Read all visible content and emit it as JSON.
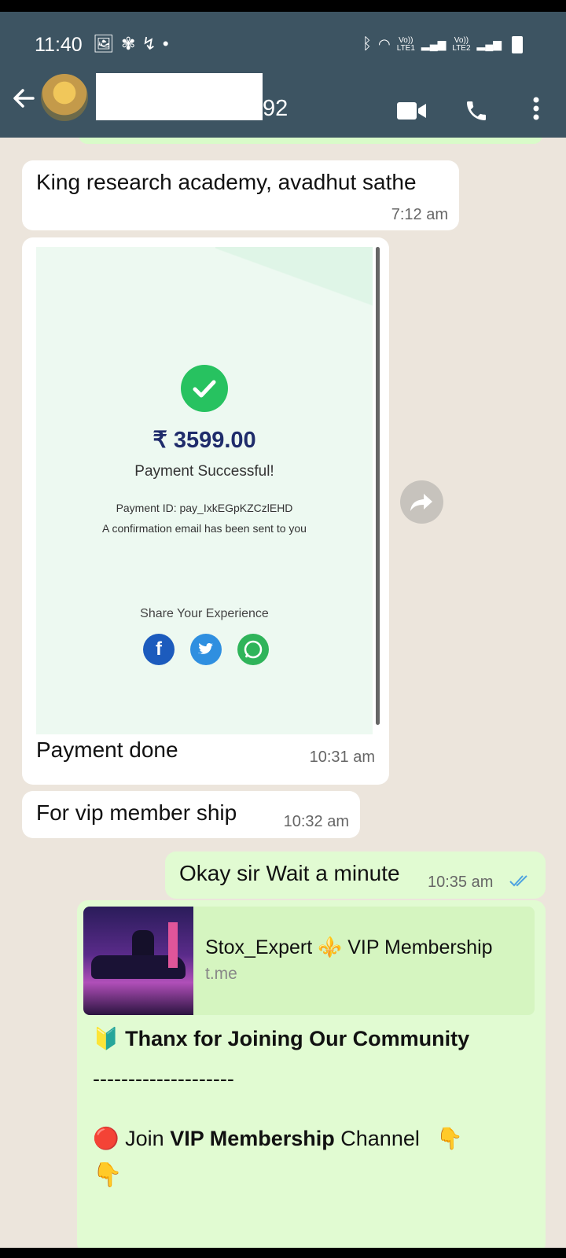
{
  "status_bar": {
    "time": "11:40",
    "net1_top": "Vo))",
    "net1_bottom": "LTE1",
    "net2_top": "Vo))",
    "net2_bottom": "LTE2"
  },
  "header": {
    "contact_name_suffix": "92"
  },
  "messages": [
    {
      "direction": "in",
      "text": "King research academy, avadhut sathe",
      "time": "7:12 am"
    },
    {
      "direction": "in",
      "type": "image",
      "caption": "Payment done",
      "time": "10:31 am",
      "image": {
        "amount": "₹ 3599.00",
        "status": "Payment Successful!",
        "payment_id": "Payment ID: pay_IxkEGpKZCzlEHD",
        "confirmation": "A confirmation email has been sent to you",
        "share_label": "Share Your Experience"
      }
    },
    {
      "direction": "in",
      "text": "For vip member ship",
      "time": "10:32 am"
    },
    {
      "direction": "out",
      "text": "Okay sir Wait a minute",
      "time": "10:35 am",
      "read": true
    },
    {
      "direction": "out",
      "type": "link",
      "link_title": "Stox_Expert ⚜️ VIP Membership",
      "link_url": "t.me",
      "line1_emoji": "🔰",
      "line1": "Thanx for Joining Our Community",
      "separator": "--------------------",
      "line2_emoji": "🔴",
      "line2_pre": "Join ",
      "line2_bold": "VIP Membership",
      "line2_post": " Channel",
      "pointer": "👇"
    }
  ],
  "colors": {
    "header_bg": "#3d5462",
    "chat_bg": "#ece5dc",
    "incoming_bubble": "#ffffff",
    "outgoing_bubble": "#e1fbd2",
    "read_tick": "#4fa3e0"
  }
}
